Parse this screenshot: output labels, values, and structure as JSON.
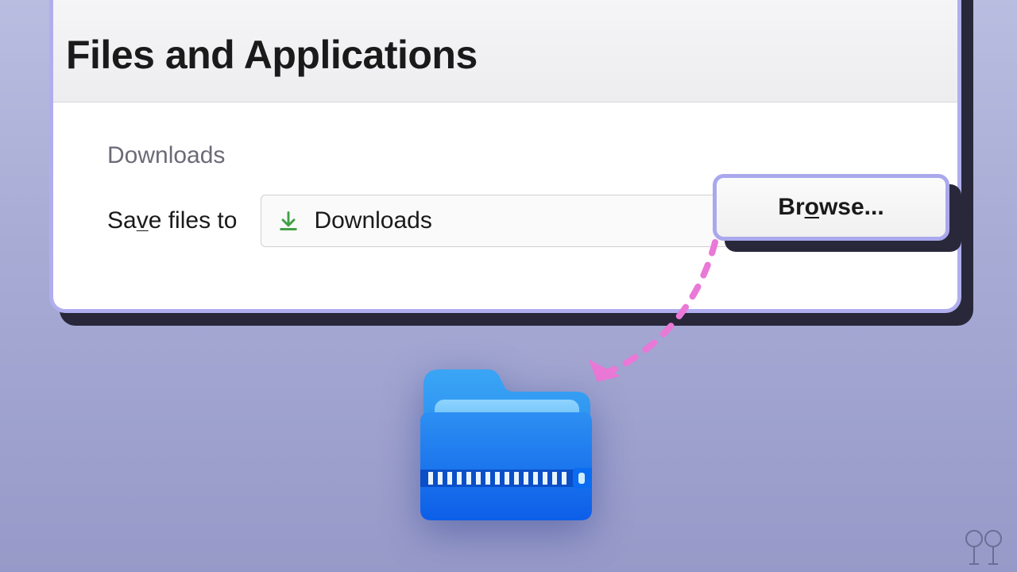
{
  "panel": {
    "title": "Files and Applications",
    "section_label": "Downloads",
    "save_label_pre": "Sa",
    "save_label_underline": "v",
    "save_label_post": "e files to",
    "path_value": "Downloads",
    "browse_pre": "Br",
    "browse_underline": "o",
    "browse_post": "wse..."
  },
  "colors": {
    "accent": "#aaa8ec",
    "download_icon": "#43a047",
    "arrow": "#e978d6"
  }
}
